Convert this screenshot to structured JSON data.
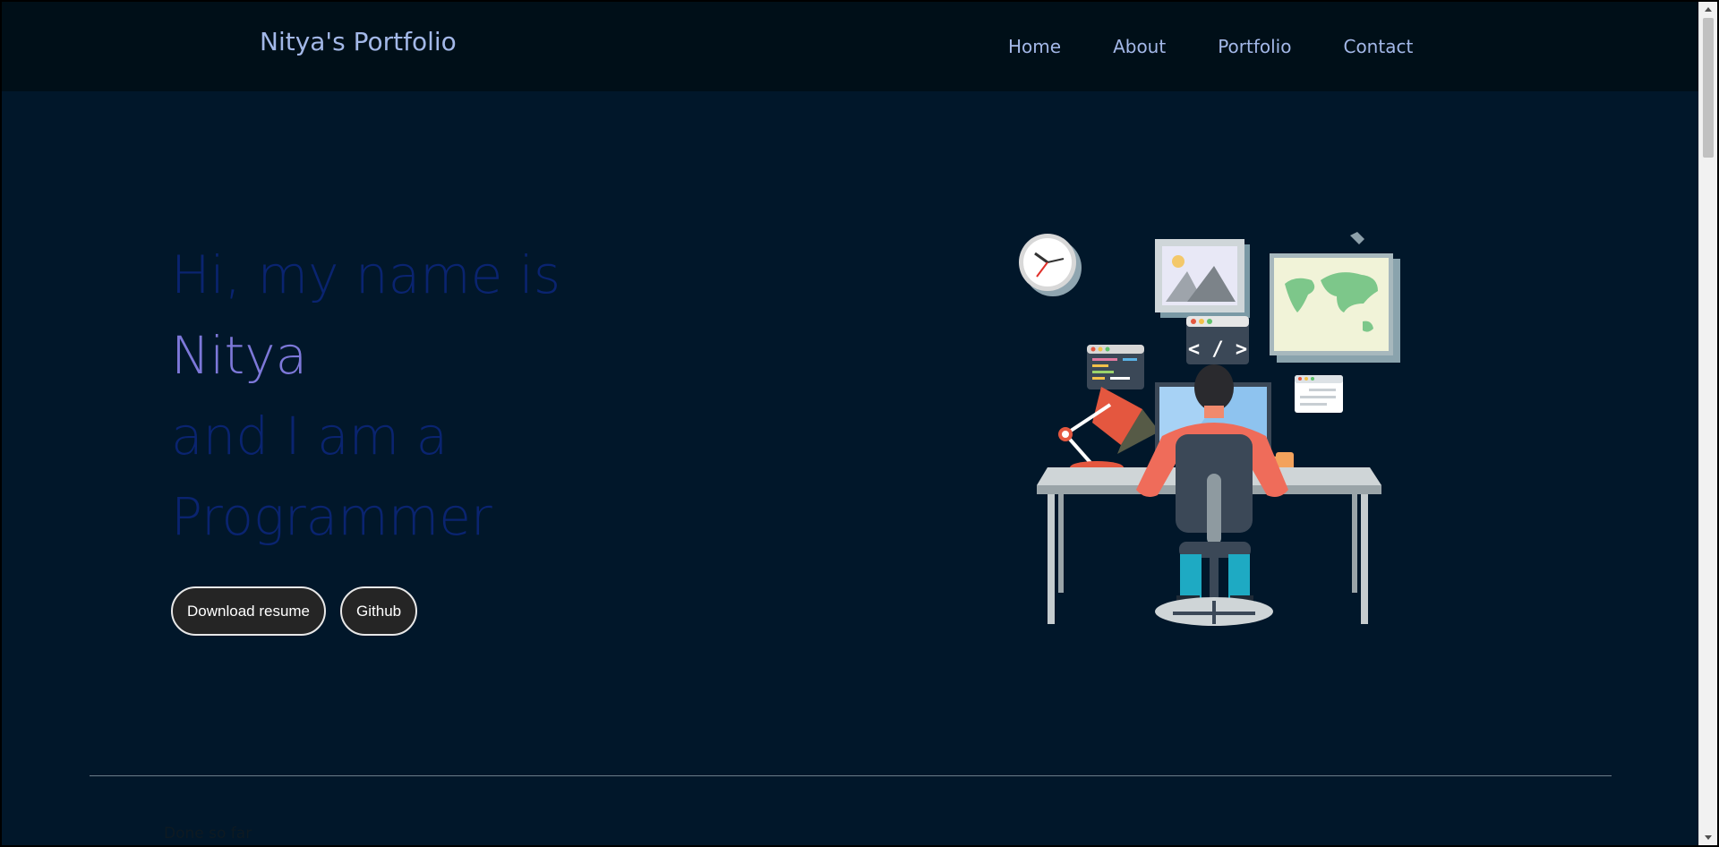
{
  "navbar": {
    "brand": "Nitya's Portfolio",
    "links": [
      "Home",
      "About",
      "Portfolio",
      "Contact"
    ]
  },
  "hero": {
    "line1": "Hi, my name is",
    "name": "Nitya",
    "line3": "and I am a",
    "line4": "Programmer"
  },
  "buttons": {
    "resume": "Download resume",
    "github": "Github"
  },
  "footer": {
    "text": "Done so far"
  },
  "illustration": {
    "code_tag": "< / >"
  },
  "colors": {
    "background": "#01172a",
    "navbar": "#000f18",
    "nav_text": "#a3b8e8",
    "hero_text": "#0a2470",
    "name_accent": "#7d78d9"
  }
}
